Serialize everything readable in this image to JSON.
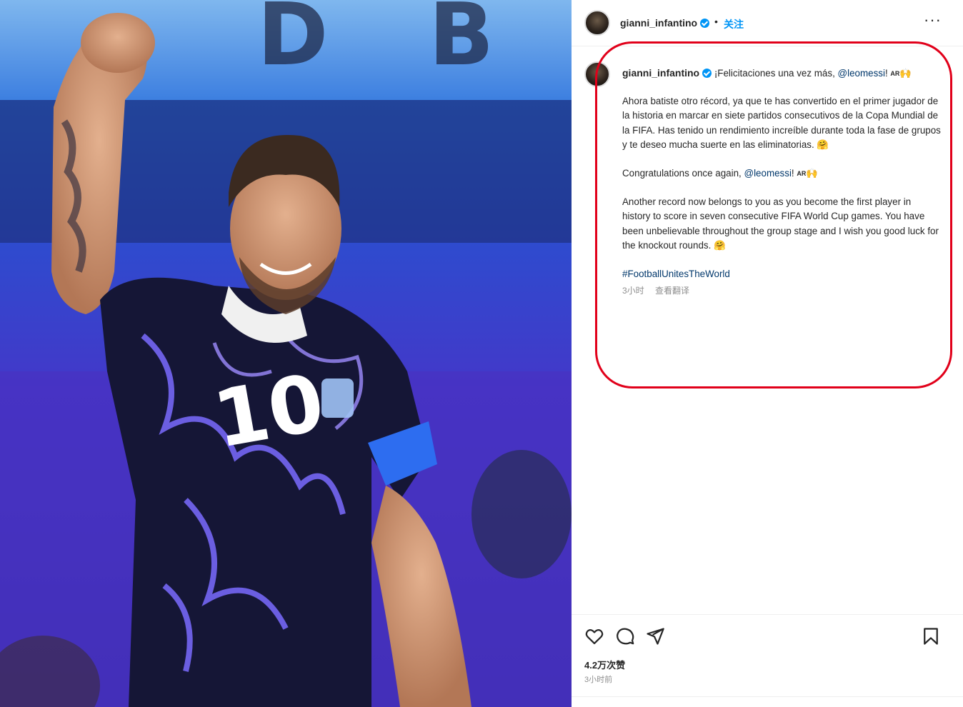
{
  "post": {
    "username": "gianni_infantino",
    "separator": "•",
    "follow_label": "关注",
    "more_label": "···",
    "image_alt": "Player in dark jersey number 10 raising fist"
  },
  "caption": {
    "username": "gianni_infantino",
    "line1_text": "¡Felicitaciones una vez más, ",
    "line1_mention": "@leomessi",
    "line1_tail": "! ",
    "flag_label": "AR",
    "emoji_clap": "🙌",
    "paragraph_es": "Ahora batiste otro récord, ya que te has convertido en el primer jugador de la historia en marcar en siete partidos consecutivos de la Copa Mundial de la FIFA. Has tenido un rendimiento increíble durante toda la fase de grupos y te deseo mucha suerte en las eliminatorias. ",
    "emoji_hug": "🤗",
    "line2_text": "Congratulations once again, ",
    "line2_mention": "@leomessi",
    "line2_tail": "! ",
    "paragraph_en": "Another record now belongs to you as you become the first player in history to score in seven consecutive FIFA World Cup games. You have been unbelievable throughout the group stage and I wish you good luck for the knockout rounds. ",
    "hashtag": "#FootballUnitesTheWorld",
    "time_ago": "3小时",
    "translate_label": "查看翻译"
  },
  "engagement": {
    "likes": "4.2万次赞",
    "time": "3小时前"
  },
  "icons": {
    "like": "heart-icon",
    "comment": "comment-icon",
    "share": "send-icon",
    "save": "bookmark-icon"
  },
  "colors": {
    "highlight_box": "#e1001a",
    "link": "#00376b",
    "follow": "#0095f6",
    "verified": "#0095f6"
  }
}
